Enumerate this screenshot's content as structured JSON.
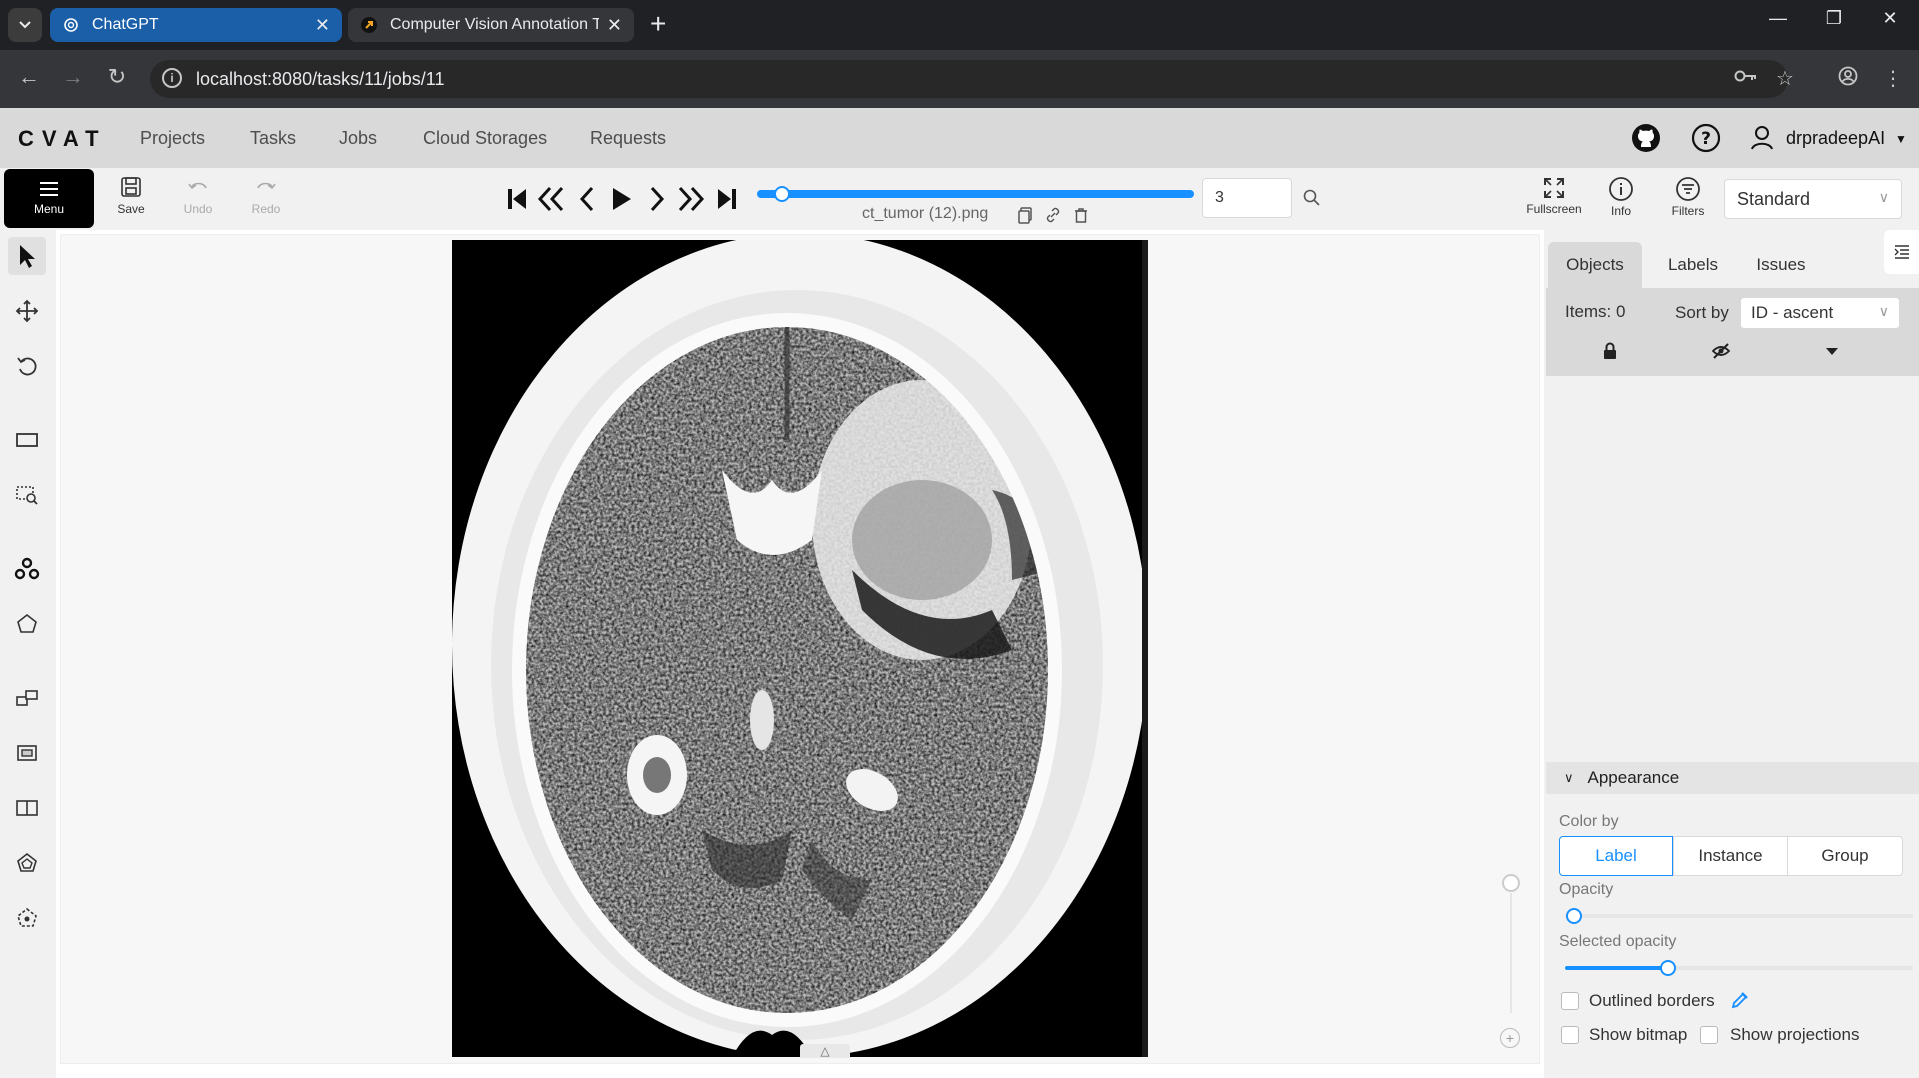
{
  "browser": {
    "tabs": [
      {
        "title": "ChatGPT",
        "favicon": "chatgpt-icon",
        "active": false
      },
      {
        "title": "Computer Vision Annotation To",
        "favicon": "cvat-icon",
        "active": true
      }
    ],
    "url": "localhost:8080/tasks/11/jobs/11"
  },
  "header": {
    "logo": "CVAT",
    "nav": [
      "Projects",
      "Tasks",
      "Jobs",
      "Cloud Storages",
      "Requests"
    ],
    "username": "drpradeepAI"
  },
  "toolbar": {
    "menu_label": "Menu",
    "save_label": "Save",
    "undo_label": "Undo",
    "redo_label": "Redo",
    "filename": "ct_tumor (12).png",
    "frame_number": "3",
    "fullscreen_label": "Fullscreen",
    "info_label": "Info",
    "filters_label": "Filters",
    "workspace": "Standard"
  },
  "sidebar": {
    "tabs": [
      "Objects",
      "Labels",
      "Issues"
    ],
    "items_count": "Items: 0",
    "sort_by_label": "Sort by",
    "sort_value": "ID - ascent",
    "appearance": {
      "title": "Appearance",
      "color_by_label": "Color by",
      "color_by_options": [
        "Label",
        "Instance",
        "Group"
      ],
      "color_by_selected": "Label",
      "opacity_label": "Opacity",
      "opacity_value": 0,
      "selected_opacity_label": "Selected opacity",
      "selected_opacity_value": 30,
      "outlined_borders_label": "Outlined borders",
      "show_bitmap_label": "Show bitmap",
      "show_projections_label": "Show projections"
    }
  },
  "colors": {
    "accent": "#1890ff",
    "chrome_dark": "#202124",
    "active_tab": "#1a5fa8"
  }
}
